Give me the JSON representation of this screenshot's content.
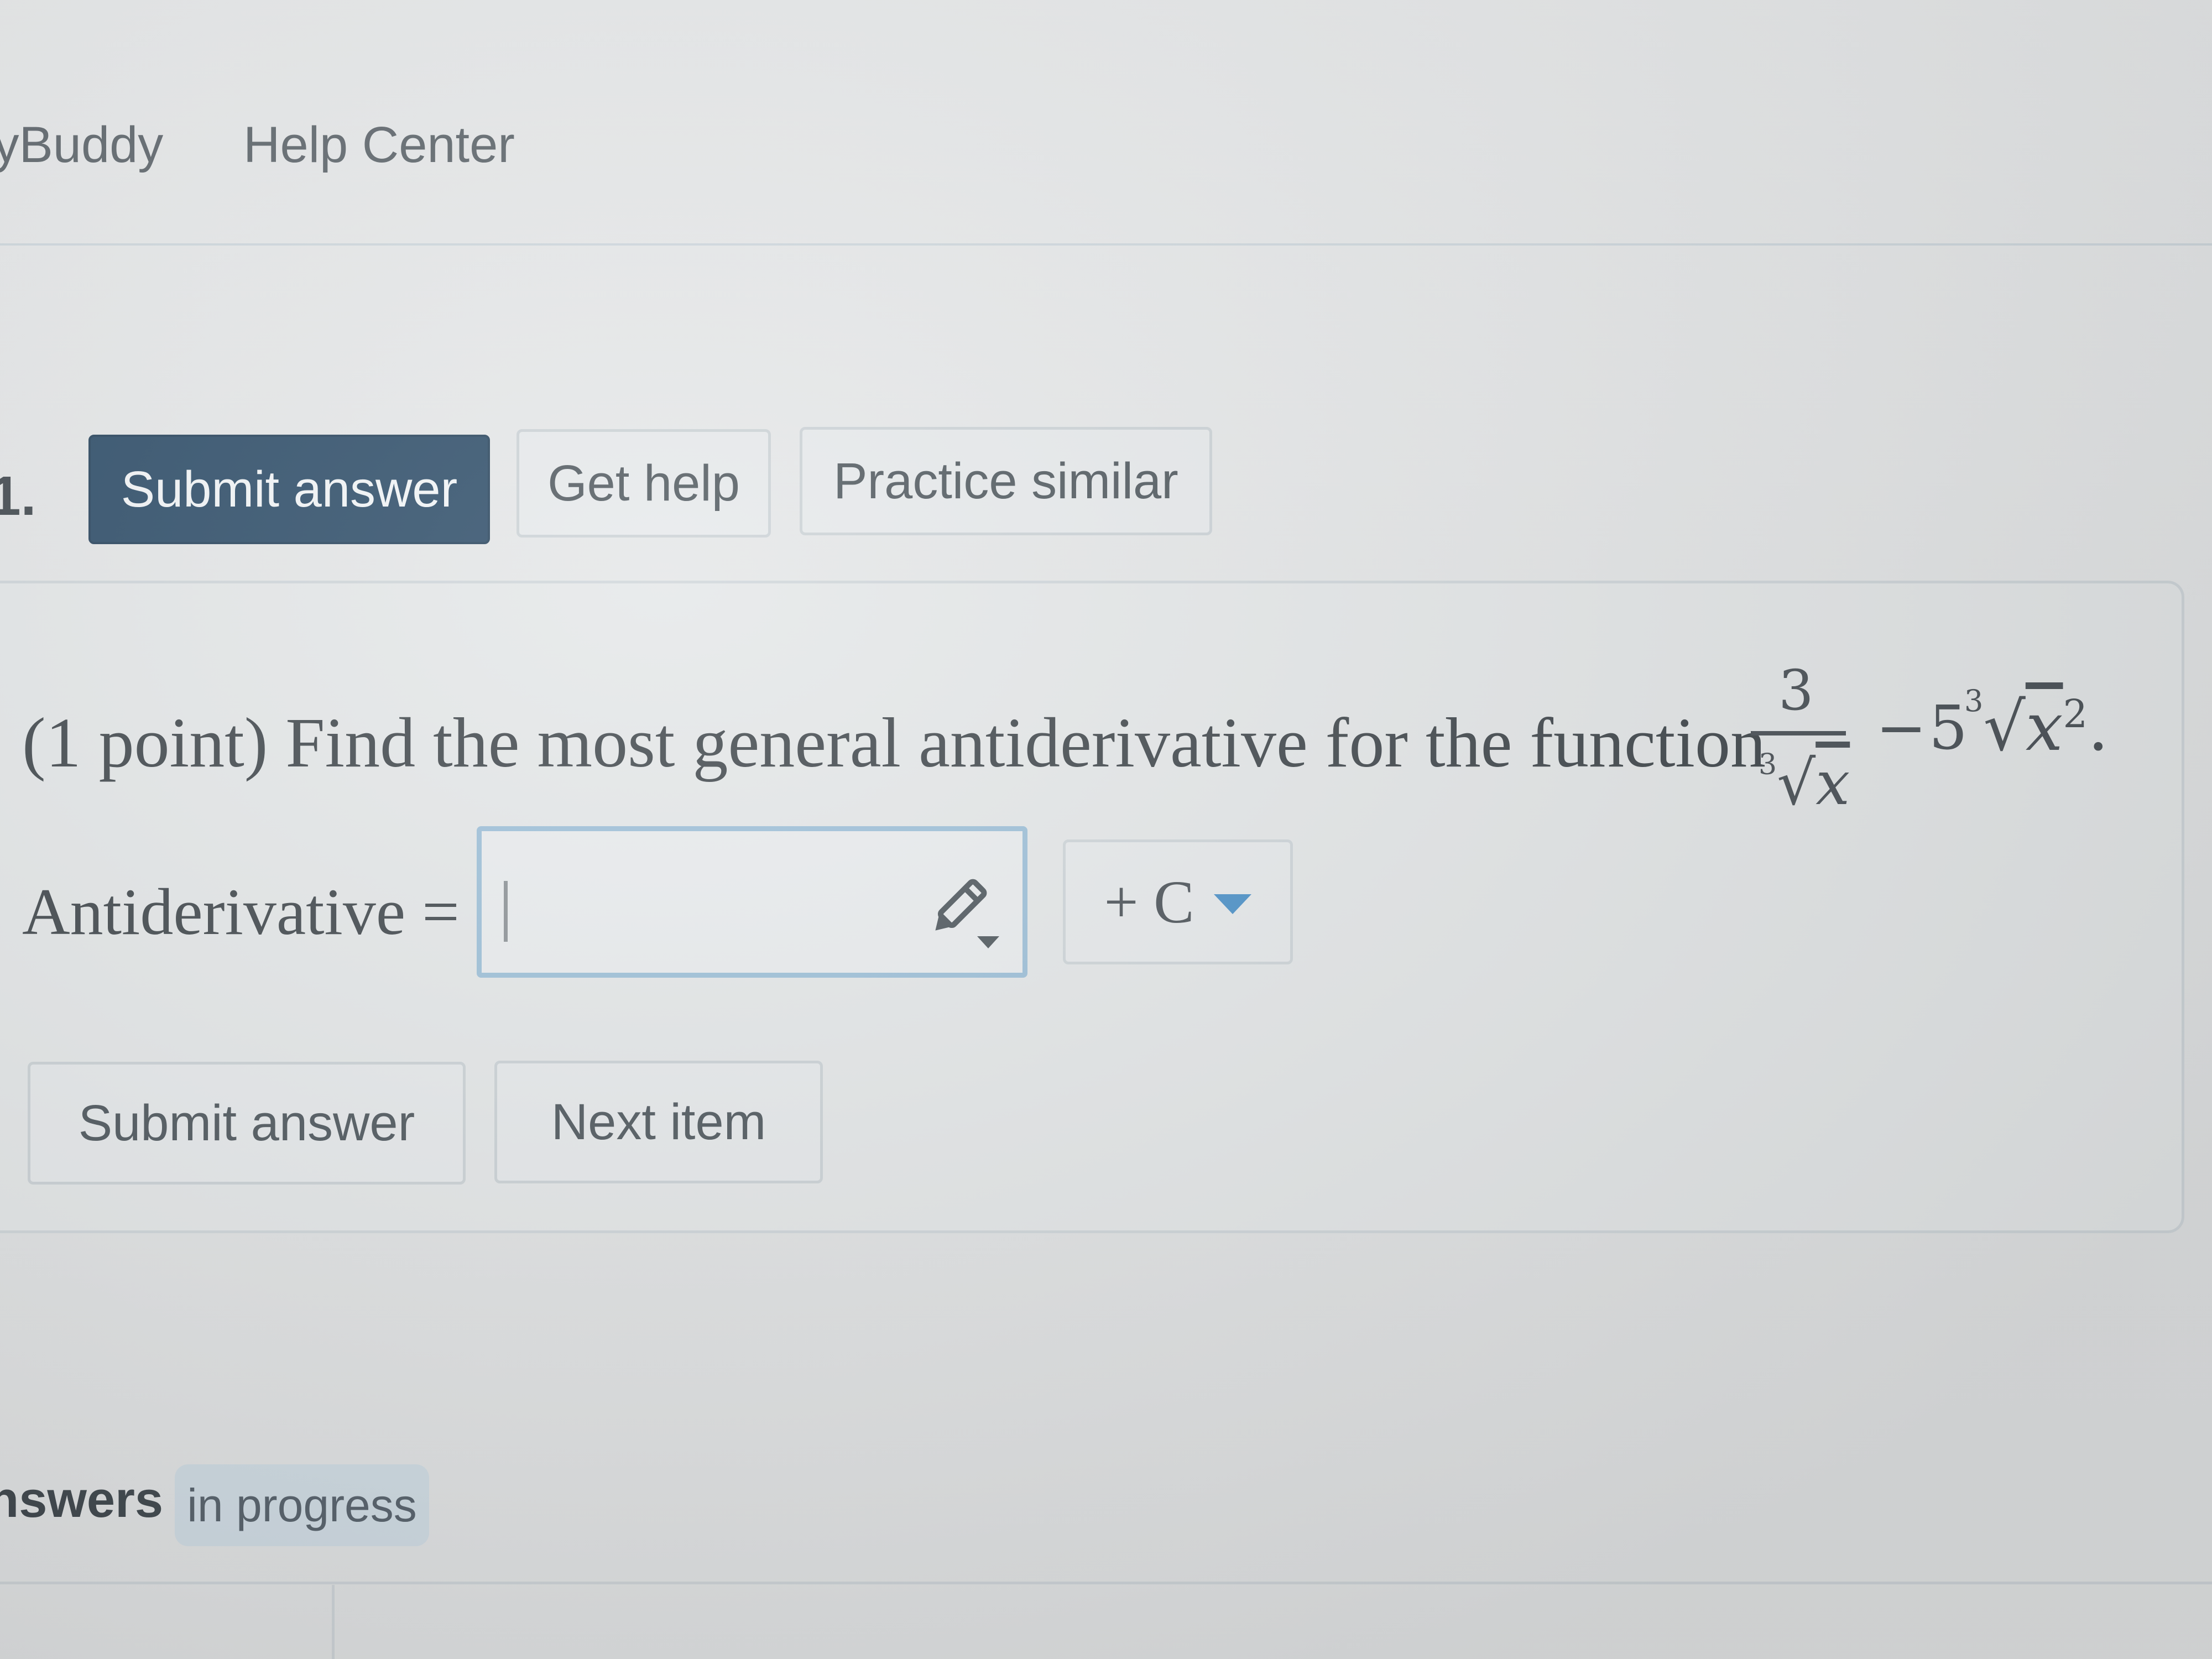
{
  "nav": {
    "mybuddy": "lyBuddy",
    "help_center": "Help Center"
  },
  "question": {
    "number": "1."
  },
  "toolbar": {
    "submit_label": "Submit answer",
    "help_label": "Get help",
    "practice_label": "Practice similar"
  },
  "problem": {
    "text": "(1 point) Find the most general antiderivative for the function",
    "function": {
      "numerator": "3",
      "denominator_index": "3",
      "denominator_radicand": "x",
      "operator": "−",
      "coefficient": "5",
      "root_index": "3",
      "root_base": "x",
      "root_exponent": "2",
      "end": "."
    }
  },
  "answer": {
    "label": "Antiderivative =",
    "value": "",
    "constant_label": "+ C",
    "pencil_icon": "pencil-icon"
  },
  "buttons": {
    "submit_label": "Submit answer",
    "next_label": "Next item"
  },
  "status": {
    "answers_label": "nswers",
    "badge": "in progress"
  },
  "colors": {
    "primary_button": "#2a4a66",
    "input_border": "#9cbfd8",
    "dropdown_arrow": "#4a90c8"
  }
}
